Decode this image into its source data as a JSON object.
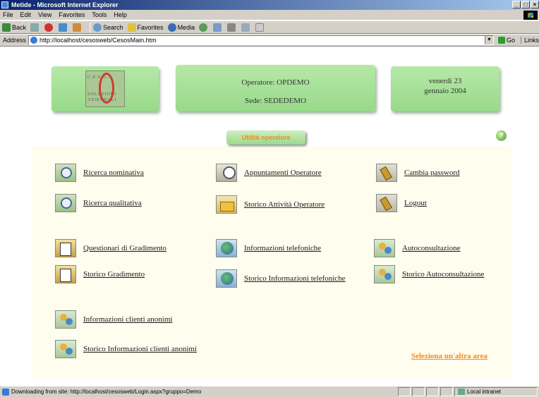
{
  "window": {
    "title": "Metide - Microsoft Internet Explorer",
    "btn_min": "_",
    "btn_max": "□",
    "btn_close": "×"
  },
  "menu": [
    "File",
    "Edit",
    "View",
    "Favorites",
    "Tools",
    "Help"
  ],
  "toolbar": {
    "back": "Back",
    "search": "Search",
    "favorites": "Favorites",
    "media": "Media"
  },
  "address": {
    "label": "Address",
    "url": "http://localhost/cesosweb/CesosMain.htm",
    "go": "Go",
    "links": "Links"
  },
  "header": {
    "operator_label": "Operatore: OPDEMO",
    "site_label": "Sede: SEDEDEMO",
    "day": "venerdì 23",
    "month_year": "gennaio 2004"
  },
  "logo": {
    "line1": "C.E.S.O.A.",
    "line2": "SOLUZIONI",
    "line3": "AZIENDALI"
  },
  "util_button": "Utilità operatore",
  "help_icon": "?",
  "menu_items": {
    "ricerca_nominativa": "Ricerca nominativa",
    "ricerca_qualitativa": "Ricerca qualitativa",
    "appuntamenti": "Appuntamenti Operatore",
    "storico_attivita": "Storico Attività Operatore",
    "cambia_password": "Cambia password",
    "logout": "Logout",
    "questionari": "Questionari di Gradimento",
    "storico_gradimento": "Storico Gradimento",
    "info_telefoniche": "Informazioni telefoniche",
    "storico_info_tel": "Storico Informazioni telefoniche",
    "autoconsultazione": "Autoconsultazione",
    "storico_autoconsultazione": "Storico Autoconsultazione",
    "info_anonimi": "Informazioni clienti anonimi",
    "storico_info_anonimi": "Storico Informazioni clienti anonimi"
  },
  "other_area": "Seleziona un'altra area",
  "status": {
    "text": "Downloading from site: http://localhost/cesosweb/Login.aspx?gruppo=Demo",
    "zone": "Local intranet"
  }
}
